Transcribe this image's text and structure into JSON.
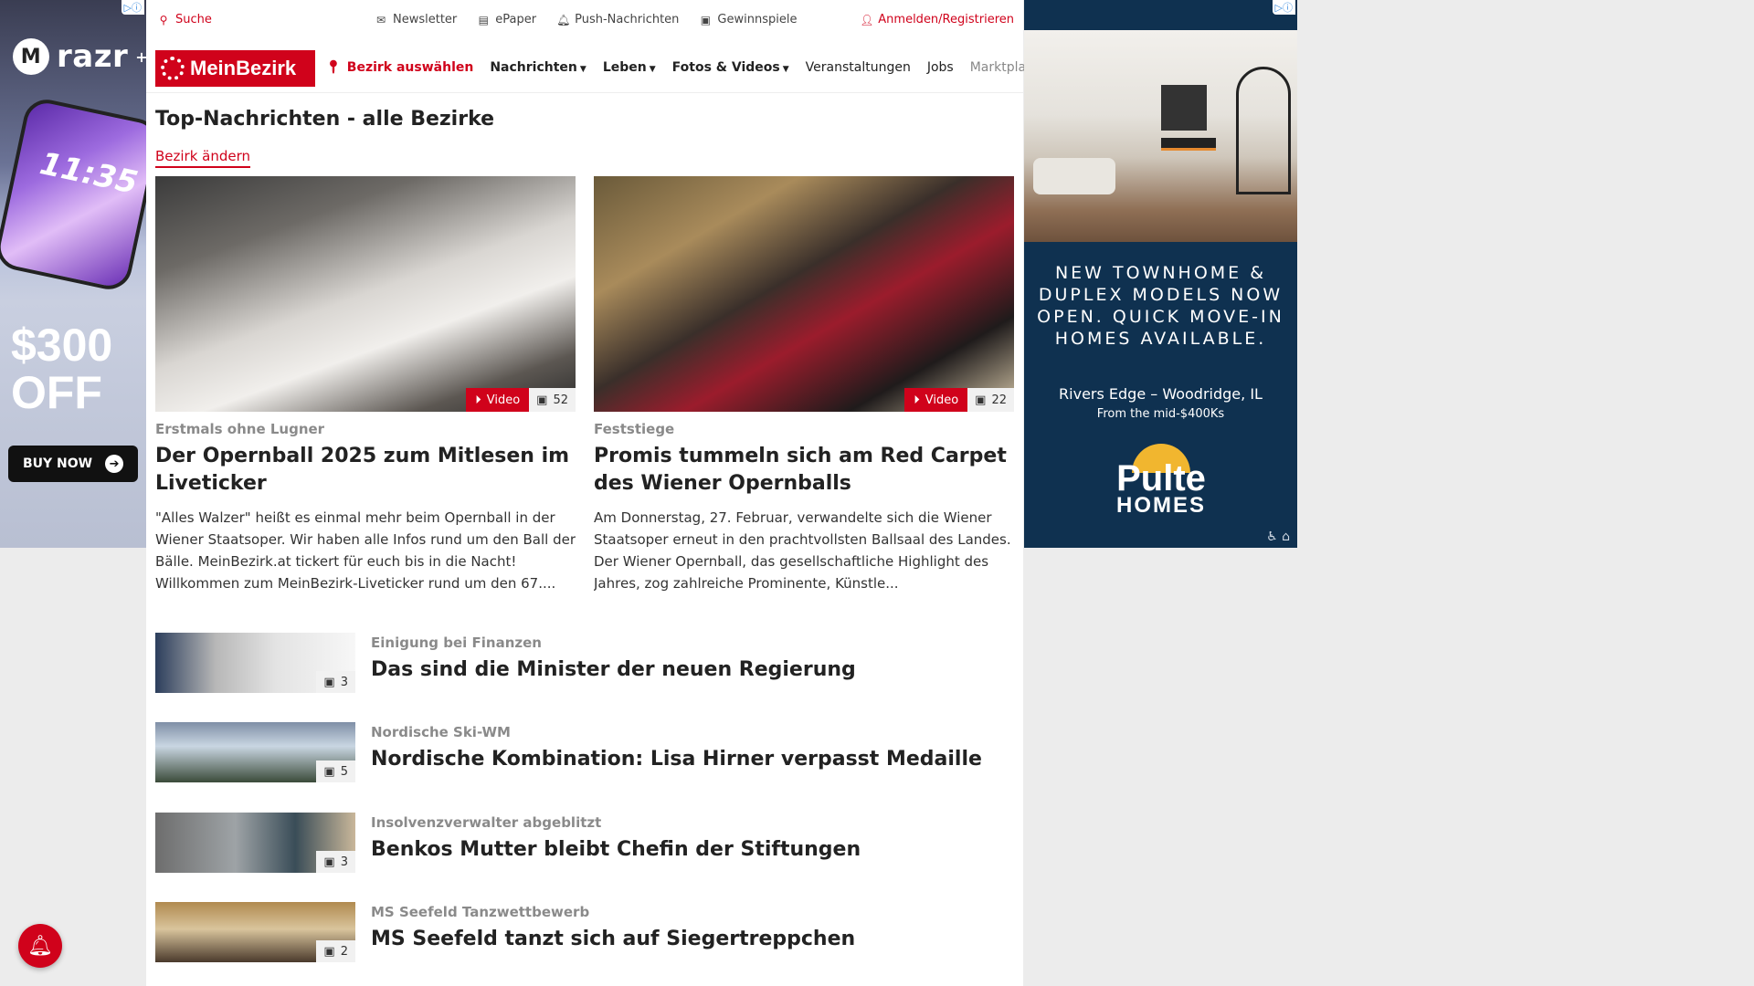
{
  "left_ad": {
    "adchoices": "▷ⓘ",
    "brand": "razr",
    "brand_sup": "+",
    "clock": "11:35",
    "offer": "$300 OFF",
    "cta": "BUY NOW"
  },
  "right_ad": {
    "adchoices": "▷ⓘ",
    "headline": "NEW TOWNHOME & DUPLEX MODELS NOW OPEN. QUICK MOVE-IN HOMES AVAILABLE.",
    "location": "Rivers Edge – Woodridge, IL",
    "price": "From the mid-$400Ks",
    "brand_top": "Pulte",
    "brand_bottom": "HOMES"
  },
  "topbar": {
    "search": "Suche",
    "newsletter": "Newsletter",
    "epaper": "ePaper",
    "push": "Push-Nachrichten",
    "gewinnspiele": "Gewinnspiele",
    "login": "Anmelden/Registrieren"
  },
  "nav": {
    "logo": "MeinBezirk",
    "bezirk": "Bezirk auswählen",
    "items": [
      "Nachrichten",
      "Leben",
      "Fotos & Videos",
      "Veranstaltungen",
      "Jobs",
      "Marktplatz"
    ]
  },
  "page": {
    "title": "Top-Nachrichten - alle Bezirke",
    "change_bezirk": "Bezirk ändern"
  },
  "featured": [
    {
      "kicker": "Erstmals ohne Lugner",
      "headline": "Der Opernball 2025 zum Mitlesen im Liveticker",
      "teaser": "\"Alles Walzer\" heißt es einmal mehr beim Opernball in der Wiener Staatsoper. Wir haben alle Infos rund um den Ball der Bälle. MeinBezirk.at tickert für euch bis in die Nacht! Willkommen zum MeinBezirk-Liveticker rund um den 67....",
      "video_label": "Video",
      "photo_count": "52"
    },
    {
      "kicker": "Feststiege",
      "headline": "Promis tummeln sich am Red Carpet des Wiener Opernballs",
      "teaser": "Am Donnerstag, 27. Februar, verwandelte sich die Wiener Staatsoper erneut in den prachtvollsten Ballsaal des Landes. Der Wiener Opernball, das gesellschaftliche Highlight des Jahres, zog zahlreiche Prominente, Künstle...",
      "video_label": "Video",
      "photo_count": "22"
    }
  ],
  "list": [
    {
      "kicker": "Einigung bei Finanzen",
      "headline": "Das sind die Minister der neuen Regierung",
      "photo_count": "3"
    },
    {
      "kicker": "Nordische Ski-WM",
      "headline": "Nordische Kombination: Lisa Hirner verpasst Medaille",
      "photo_count": "5"
    },
    {
      "kicker": "Insolvenzverwalter abgeblitzt",
      "headline": "Benkos Mutter bleibt Chefin der Stiftungen",
      "photo_count": "3"
    },
    {
      "kicker": "MS Seefeld Tanzwettbewerb",
      "headline": "MS Seefeld tanzt sich auf Siegertreppchen",
      "photo_count": "2"
    }
  ],
  "colors": {
    "brand_red": "#d0021b",
    "ad_navy": "#0f3150"
  }
}
